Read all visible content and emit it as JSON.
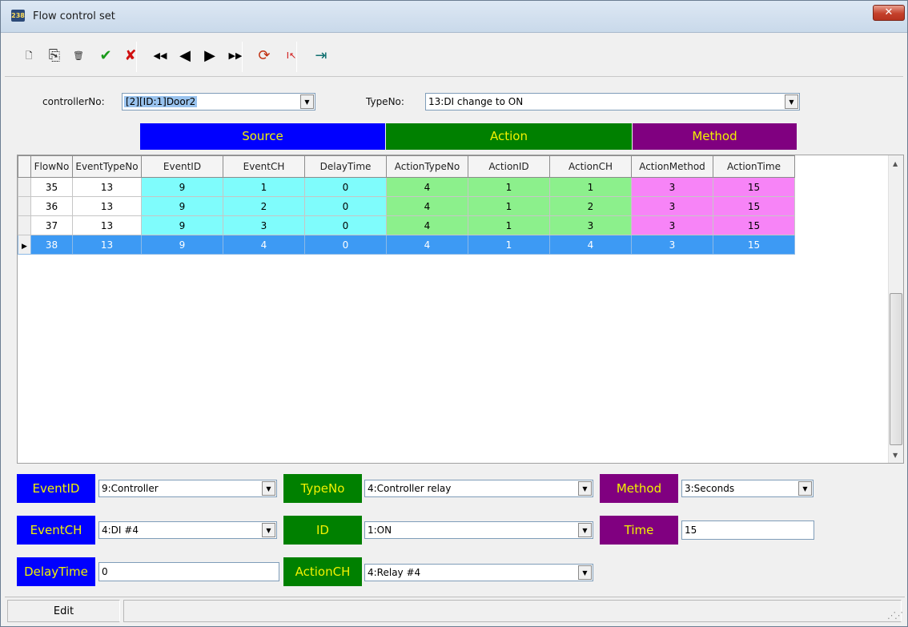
{
  "window": {
    "title": "Flow control set",
    "close_glyph": "✕",
    "app_icon_text": "238"
  },
  "toolbar": [
    {
      "name": "new-record-button",
      "icon": "new-document-icon",
      "glyph": "🗋",
      "color": "#000000"
    },
    {
      "name": "copy-record-button",
      "icon": "copy-icon",
      "glyph": "⎘",
      "color": "#333333"
    },
    {
      "name": "delete-record-button",
      "icon": "trash-icon",
      "glyph": "🗑",
      "color": "#333333"
    },
    {
      "name": "post-button",
      "icon": "checkmark-icon",
      "glyph": "✔",
      "color": "#1a9a1a"
    },
    {
      "name": "cancel-button",
      "icon": "x-icon",
      "glyph": "✘",
      "color": "#d01010"
    },
    {
      "name": "first-record-button",
      "icon": "first-icon",
      "glyph": "◀◀",
      "color": "#000000"
    },
    {
      "name": "prior-record-button",
      "icon": "prior-icon",
      "glyph": "◀",
      "color": "#000000"
    },
    {
      "name": "next-record-button",
      "icon": "next-icon",
      "glyph": "▶",
      "color": "#000000"
    },
    {
      "name": "last-record-button",
      "icon": "last-icon",
      "glyph": "▶▶",
      "color": "#000000"
    },
    {
      "name": "refresh-button",
      "icon": "refresh-icon",
      "glyph": "⟳",
      "color": "#c03010"
    },
    {
      "name": "edit-cursor-button",
      "icon": "text-cursor-icon",
      "glyph": "I↖",
      "color": "#d01010"
    },
    {
      "name": "exit-button",
      "icon": "exit-icon",
      "glyph": "⇥",
      "color": "#107070"
    }
  ],
  "filters": {
    "controller_label": "controllerNo:",
    "controller_value": "[2][ID:1]Door2",
    "type_label": "TypeNo:",
    "type_value": "13:DI change to ON",
    "arrow": "▼"
  },
  "bands": {
    "source": "Source",
    "action": "Action",
    "method": "Method",
    "colors": {
      "source": "#0000ff",
      "action": "#008000",
      "method": "#800080",
      "text": "#f2f200"
    }
  },
  "grid": {
    "columns": [
      "FlowNo",
      "EventTypeNo",
      "EventID",
      "EventCH",
      "DelayTime",
      "ActionTypeNo",
      "ActionID",
      "ActionCH",
      "ActionMethod",
      "ActionTime"
    ],
    "rows": [
      [
        "35",
        "13",
        "9",
        "1",
        "0",
        "4",
        "1",
        "1",
        "3",
        "15"
      ],
      [
        "36",
        "13",
        "9",
        "2",
        "0",
        "4",
        "1",
        "2",
        "3",
        "15"
      ],
      [
        "37",
        "13",
        "9",
        "3",
        "0",
        "4",
        "1",
        "3",
        "3",
        "15"
      ],
      [
        "38",
        "13",
        "9",
        "4",
        "0",
        "4",
        "1",
        "4",
        "3",
        "15"
      ]
    ],
    "selected_row": 3,
    "row_indicator": "▶"
  },
  "form": {
    "event_id_label": "EventID",
    "event_id_value": "9:Controller",
    "event_ch_label": "EventCH",
    "event_ch_value": "4:DI #4",
    "delay_time_label": "DelayTime",
    "delay_time_value": "0",
    "type_no_label": "TypeNo",
    "type_no_value": "4:Controller relay",
    "id_label": "ID",
    "id_value": "1:ON",
    "action_ch_label": "ActionCH",
    "action_ch_value": "4:Relay #4",
    "method_label": "Method",
    "method_value": "3:Seconds",
    "time_label": "Time",
    "time_value": "15"
  },
  "status": {
    "mode": "Edit"
  }
}
